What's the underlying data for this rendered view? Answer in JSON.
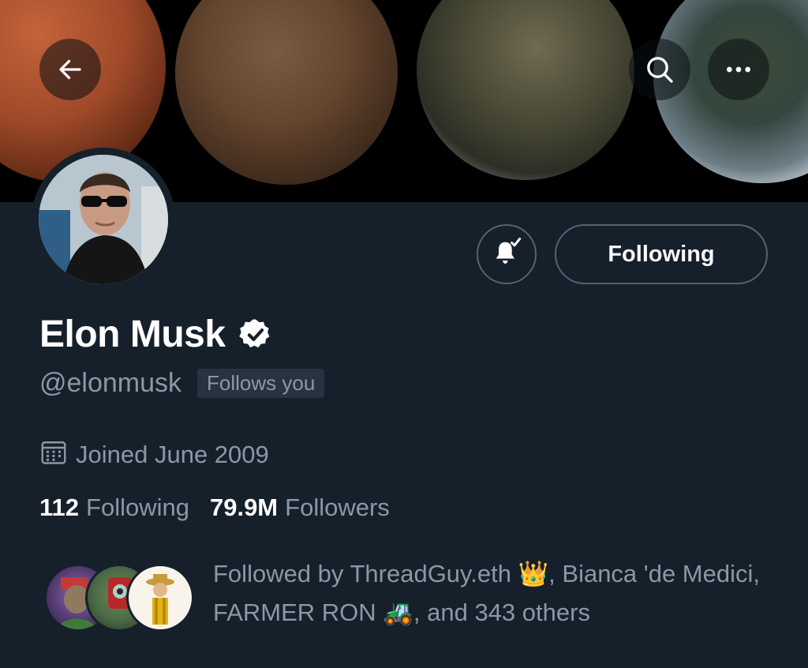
{
  "header": {
    "back_icon": "arrow-left-icon",
    "search_icon": "search-icon",
    "more_icon": "more-horizontal-icon"
  },
  "profile": {
    "display_name": "Elon Musk",
    "verified_icon": "verified-badge-icon",
    "handle": "@elonmusk",
    "follows_you": "Follows you",
    "joined_icon": "calendar-icon",
    "joined": "Joined June 2009",
    "following_count": "112",
    "following_label": "Following",
    "followers_count": "79.9M",
    "followers_label": "Followers"
  },
  "actions": {
    "notify_icon": "bell-check-icon",
    "follow_label": "Following"
  },
  "followed_by": {
    "text": "Followed by ThreadGuy.eth 👑, Bianca 'de Medici, FARMER RON 🚜, and 343 others"
  },
  "colors": {
    "background": "#15202b",
    "muted_text": "#8b98a5",
    "border": "#536471",
    "primary_text": "#ffffff"
  }
}
